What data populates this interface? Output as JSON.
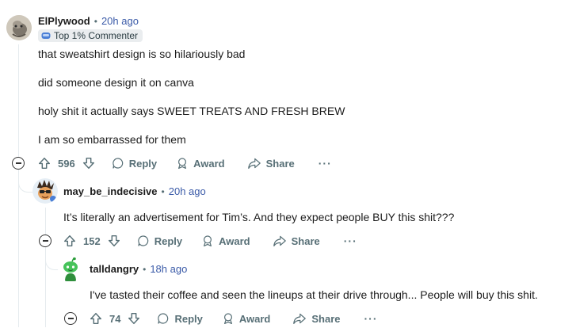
{
  "comments": [
    {
      "username": "ElPlywood",
      "time": "20h ago",
      "flair": "Top 1% Commenter",
      "body": [
        "that sweatshirt design is so hilariously bad",
        "did someone design it on canva",
        "holy shit it actually says SWEET TREATS AND FRESH BREW",
        "I am so embarrassed for them"
      ],
      "votes": "596",
      "reply_label": "Reply",
      "award_label": "Award",
      "share_label": "Share",
      "more_label": "···"
    },
    {
      "username": "may_be_indecisive",
      "time": "20h ago",
      "body": [
        "It’s literally an advertisement for Tim’s. And they expect people BUY this shit???"
      ],
      "votes": "152",
      "reply_label": "Reply",
      "award_label": "Award",
      "share_label": "Share",
      "more_label": "···"
    },
    {
      "username": "talldangry",
      "time": "18h ago",
      "body": [
        "I've tasted their coffee and seen the lineups at their drive through... People will buy this shit."
      ],
      "votes": "74",
      "reply_label": "Reply",
      "award_label": "Award",
      "share_label": "Share",
      "more_label": "···"
    }
  ],
  "separator": "•",
  "colors": {
    "meta": "#576f76",
    "time": "#3b5ba8",
    "flair_bg": "#eaedef",
    "thread_line": "#e5ebee"
  },
  "icons": [
    "upvote-icon",
    "downvote-icon",
    "reply-bubble-icon",
    "award-icon",
    "share-icon",
    "collapse-icon",
    "flair-commenter-icon"
  ]
}
